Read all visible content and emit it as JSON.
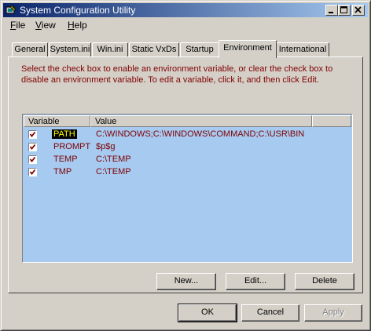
{
  "window": {
    "title": "System Configuration Utility"
  },
  "menu": [
    {
      "label": "File",
      "key": "F",
      "rest": "ile"
    },
    {
      "label": "View",
      "key": "V",
      "rest": "iew"
    },
    {
      "label": "Help",
      "key": "H",
      "rest": "elp"
    }
  ],
  "tabs": [
    "General",
    "System.ini",
    "Win.ini",
    "Static VxDs",
    "Startup",
    "Environment",
    "International"
  ],
  "active_tab": "Environment",
  "instructions": "Select the check box to enable an environment variable, or clear the check box to disable an environment variable. To edit a variable, click it, and then click Edit.",
  "list": {
    "columns": [
      "Variable",
      "Value"
    ],
    "rows": [
      {
        "name": "PATH",
        "value": "C:\\WINDOWS;C:\\WINDOWS\\COMMAND;C:\\USR\\BIN",
        "checked": true,
        "selected": true
      },
      {
        "name": "PROMPT",
        "value": "$p$g",
        "checked": true,
        "selected": false
      },
      {
        "name": "TEMP",
        "value": "C:\\TEMP",
        "checked": true,
        "selected": false
      },
      {
        "name": "TMP",
        "value": "C:\\TEMP",
        "checked": true,
        "selected": false
      }
    ]
  },
  "buttons": {
    "new": "New...",
    "edit": "Edit...",
    "delete": "Delete",
    "ok": "OK",
    "cancel": "Cancel",
    "apply": "Apply"
  },
  "colors": {
    "title_start": "#0a246a",
    "title_end": "#a6caf0",
    "list_bg": "#a6caf0",
    "text_accent": "#800000",
    "selection_text": "#ffff00"
  },
  "icons": [
    "app-icon",
    "minimize-icon",
    "maximize-icon",
    "close-icon",
    "checkmark-icon"
  ]
}
